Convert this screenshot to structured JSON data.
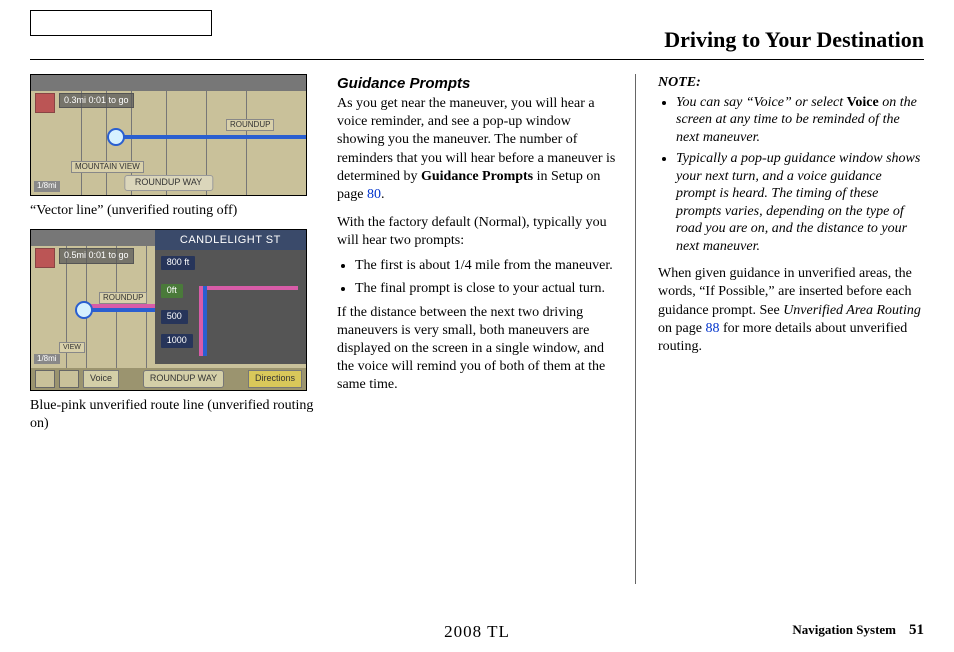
{
  "header": {
    "title": "Driving to Your Destination"
  },
  "col1": {
    "map1": {
      "distance": "0.3mi 0:01 to go",
      "roundup": "ROUNDUP",
      "mountain": "MOUNTAIN VIEW",
      "pill": "ROUNDUP WAY",
      "scale": "1/8mi"
    },
    "caption1": "“Vector line” (unverified routing off)",
    "map2": {
      "distance": "0.5mi 0:01 to go",
      "scale": "1/8mi",
      "roundup": "ROUNDUP",
      "view": "VIEW",
      "street": "CANDLELIGHT ST",
      "d800": "800 ft",
      "d0": "0ft",
      "d500": "500",
      "d1000": "1000",
      "voice_btn": "Voice",
      "pill": "ROUNDUP WAY",
      "directions_btn": "Directions"
    },
    "caption2": "Blue-pink unverified route line (unverified routing on)"
  },
  "col2": {
    "heading": "Guidance Prompts",
    "p1a": "As you get near the maneuver, you will hear a voice reminder, and see a pop-up window showing you the maneuver. The number of reminders that you will hear before a maneuver is determined by ",
    "p1b_bold": "Guidance Prompts",
    "p1c": " in Setup on page ",
    "p1_link": "80",
    "p1d": ".",
    "p2": "With the factory default (Normal), typically you will hear two prompts:",
    "b1": "The first is about 1/4 mile from the maneuver.",
    "b2": "The final prompt is close to your actual turn.",
    "p3": "If the distance between the next two driving maneuvers is very small, both maneuvers are displayed on the screen in a single window, and the voice will remind you of both of them at the same time."
  },
  "col3": {
    "note_label": "NOTE:",
    "n1a": "You can say “Voice” or select ",
    "n1_bold": "Voice",
    "n1b": " on the screen at any time to be reminded of the next maneuver.",
    "n2": "Typically a pop-up guidance window shows your next turn, and a voice guidance prompt is heard. The timing of these prompts varies, depending on the type of road you are on, and the distance to your next maneuver.",
    "p1a": "When given guidance in unverified areas, the words, “If Possible,” are inserted before each guidance prompt. See ",
    "p1_ital": "Unverified Area Routing",
    "p1b": " on page ",
    "p1_link": "88",
    "p1c": " for more details about unverified routing."
  },
  "footer": {
    "center": "2008  TL",
    "label": "Navigation System",
    "page": "51"
  }
}
